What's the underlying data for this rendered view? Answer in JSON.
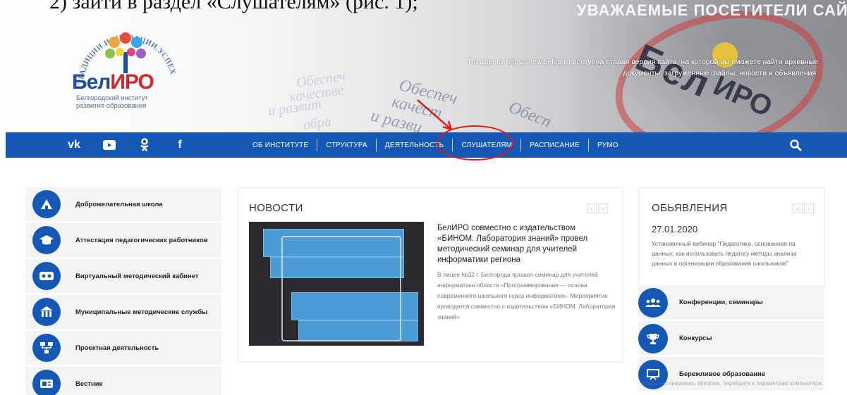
{
  "document": {
    "caption": "2) зайти в раздел «Слушателям» (рис. 1);"
  },
  "banner": {
    "welcome": "УВАЖАЕМЫЕ ПОСЕТИТЕЛИ САЙТА!",
    "notice": "По адресу https://new.beliro.ru доступна старая версия сайта, на которой вы сможете найти архивные документы, загруженные файлы, новости и объявления.",
    "watermarks": [
      "Обеспеч",
      "качестве",
      "и развит",
      "обра",
      "Обеспеч",
      "качест",
      "и разви",
      "Обесп"
    ],
    "stamp_text": "Бел",
    "stamp_text2": "ИРО"
  },
  "logo": {
    "arc_text": "ТРАДИЦИИ.ИННОВАЦИИ.УСПЕХ",
    "name_part1": "Бел",
    "name_part2": "ИРО",
    "subtitle_line1": "Белгородский институт",
    "subtitle_line2": "развития образования"
  },
  "nav": {
    "social": [
      {
        "icon": "vk-icon",
        "glyph": "vk"
      },
      {
        "icon": "youtube-icon",
        "glyph": "▶"
      },
      {
        "icon": "odnoklassniki-icon",
        "glyph": "ꭷ"
      },
      {
        "icon": "facebook-icon",
        "glyph": "f"
      }
    ],
    "menu": [
      "ОБ ИНСТИТУТЕ",
      "СТРУКТУРА",
      "ДЕЯТЕЛЬНОСТЬ",
      "СЛУШАТЕЛЯМ",
      "РАСПИСАНИЕ",
      "РУМО"
    ],
    "highlighted": "СЛУШАТЕЛЯМ",
    "search_icon": "search-icon"
  },
  "sidebar": {
    "items": [
      {
        "label": "Доброжелательная школа",
        "icon": "school-icon"
      },
      {
        "label": "Аттестация педагогических работников",
        "icon": "graduation-cap-icon"
      },
      {
        "label": "Виртуальный методический кабинет",
        "icon": "vr-headset-icon"
      },
      {
        "label": "Муниципальные методические службы",
        "icon": "building-icon"
      },
      {
        "label": "Проектная деятельность",
        "icon": "sitemap-icon"
      },
      {
        "label": "Вестник",
        "icon": "newspaper-icon"
      }
    ]
  },
  "news": {
    "title": "НОВОСТИ",
    "pager_prev": "‹",
    "pager_next": "›",
    "headline": "БелИРО совместно с издательством «БИНОМ. Лаборатория знаний» провел методический семинар для учителей информатики региона",
    "excerpt": "В лицее №32 г. Белгорода прошел семинар для учителей информатики области «Программирование — основа современного школьного курса информатики». Мероприятие проводится совместно с издательством «БИНОМ. Лаборатория знаний»"
  },
  "announcements": {
    "title": "ОБЬЯВЛЕНИЯ",
    "pager_prev": "‹",
    "pager_next": "›",
    "date": "27.01.2020",
    "text": "Установочный вебинар \"Педагогика, основанная на данных: как использовать педагогу методы анализа данных в организации образования школьников\""
  },
  "right_links": [
    {
      "label": "Конференции, семинары",
      "icon": "users-icon"
    },
    {
      "label": "Конкурсы",
      "icon": "trophy-icon"
    },
    {
      "label": "Бережливое образование",
      "icon": "presentation-icon"
    }
  ],
  "activation_notice": "Чтобы активировать Windows, перейдите к параметрам компьютера.",
  "colors": {
    "brand_blue": "#1557b5",
    "annotation_red": "#d42020",
    "logo_red": "#d3262e"
  }
}
